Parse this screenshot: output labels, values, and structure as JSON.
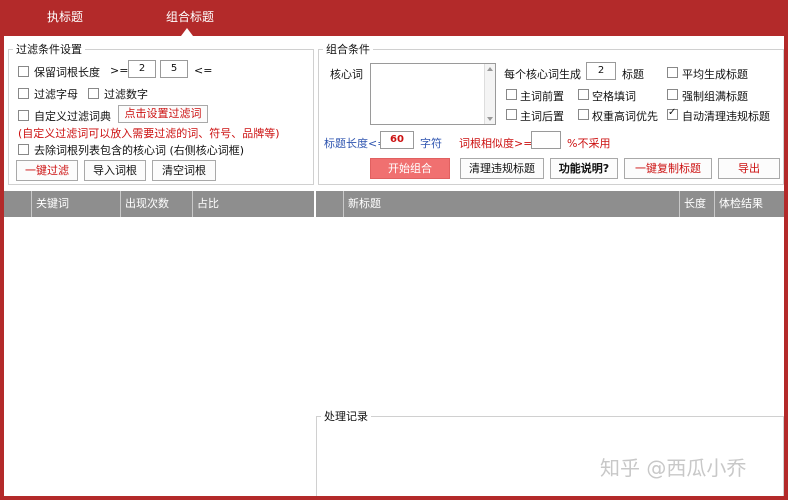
{
  "tabs": [
    {
      "label": "执标题"
    },
    {
      "label": "组合标题"
    }
  ],
  "filter": {
    "legend": "过滤条件设置",
    "keep_length_label": "保留词根长度",
    "gte": ">=",
    "min_len": "2",
    "max_len": "5",
    "lte": "<=",
    "filter_letters": "过滤字母",
    "filter_digits": "过滤数字",
    "custom_dict": "自定义过滤词典",
    "set_filter_button": "点击设置过滤词",
    "custom_hint": "(自定义过滤词可以放入需要过滤的词、符号、品牌等)",
    "remove_core": "去除词根列表包含的核心词 (右侧核心词框)",
    "one_key_filter": "一键过滤",
    "import_roots": "导入词根",
    "clear_roots": "清空词根"
  },
  "combine": {
    "legend": "组合条件",
    "core_word_label": "核心词",
    "per_core_label": "每个核心词生成",
    "per_core_value": "2",
    "titles_unit": "标题",
    "avg_gen": "平均生成标题",
    "root_front": "主词前置",
    "space_fill": "空格填词",
    "force_full": "强制组满标题",
    "root_back": "主词后置",
    "weight_priority": "权重高词优先",
    "auto_clean": "自动清理违规标题",
    "title_len_label": "标题长度<=",
    "title_len_value": "60",
    "chars_unit": "字符",
    "similarity_label": "词根相似度>=",
    "similarity_value": "",
    "not_used": "%不采用",
    "start_button": "开始组合",
    "clean_button": "清理违规标题",
    "help_button": "功能说明?",
    "copy_button": "一键复制标题",
    "export_button": "导出"
  },
  "left_table": {
    "columns": [
      "关键词",
      "出现次数",
      "占比"
    ]
  },
  "right_table": {
    "columns": [
      "新标题",
      "长度",
      "体检结果"
    ]
  },
  "log": {
    "legend": "处理记录"
  },
  "watermark": "知乎 @西瓜小乔",
  "colors": {
    "brand": "#b32a2a",
    "accent_red": "#cc1111",
    "blue_label": "#2f55b0",
    "header_gray": "#8e8e8e"
  }
}
